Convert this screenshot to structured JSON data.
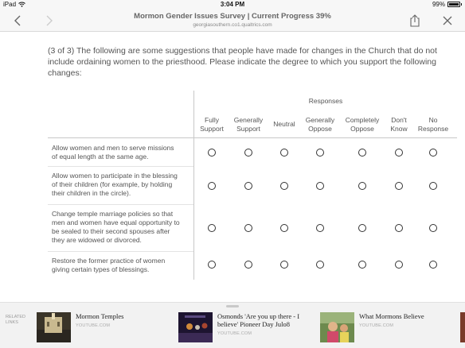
{
  "status_bar": {
    "device": "iPad",
    "time": "3:04 PM",
    "battery": "99%"
  },
  "nav": {
    "title": "Mormon Gender Issues Survey | Current Progress 39%",
    "url": "georgiasouthern.co1.qualtrics.com"
  },
  "question": {
    "text": "(3 of 3) The following are some suggestions that people have made for changes in the Church that do not include ordaining women to the priesthood. Please indicate the degree to which you support the following changes:"
  },
  "matrix": {
    "group_header": "Responses",
    "columns": [
      [
        "Fully",
        "Support"
      ],
      [
        "Generally",
        "Support"
      ],
      [
        "Neutral"
      ],
      [
        "Generally",
        "Oppose"
      ],
      [
        "Completely",
        "Oppose"
      ],
      [
        "Don't",
        "Know"
      ],
      [
        "No",
        "Response"
      ]
    ],
    "rows": [
      [
        "Allow women and men to serve missions",
        "of equal length at the same age."
      ],
      [
        "Allow women to participate in the blessing",
        "of their children (for example, by holding",
        "their children in the circle)."
      ],
      [
        "Change temple marriage policies so that",
        "men and women have equal opportunity to",
        "be sealed to their second spouses after",
        "they are widowed or divorced."
      ],
      [
        "Restore the former practice of women",
        "giving certain types of blessings."
      ]
    ]
  },
  "related": {
    "label": [
      "RELATED",
      "LINKS"
    ],
    "items": [
      {
        "title": [
          "Mormon Temples"
        ],
        "source": "YOUTUBE.COM"
      },
      {
        "title": [
          "Osmonds 'Are you up there - I",
          "believe' Pioneer Day Julo8"
        ],
        "source": "YOUTUBE.COM"
      },
      {
        "title": [
          "What Mormons Believe"
        ],
        "source": "YOUTUBE.COM"
      }
    ]
  },
  "colors": {
    "accent": "#555555",
    "nav_bg": "#f7f7f7",
    "related_bg": "#f2f2f2"
  },
  "icons": [
    "wifi-icon",
    "back-chevron-icon",
    "forward-chevron-icon",
    "share-icon",
    "close-icon"
  ]
}
